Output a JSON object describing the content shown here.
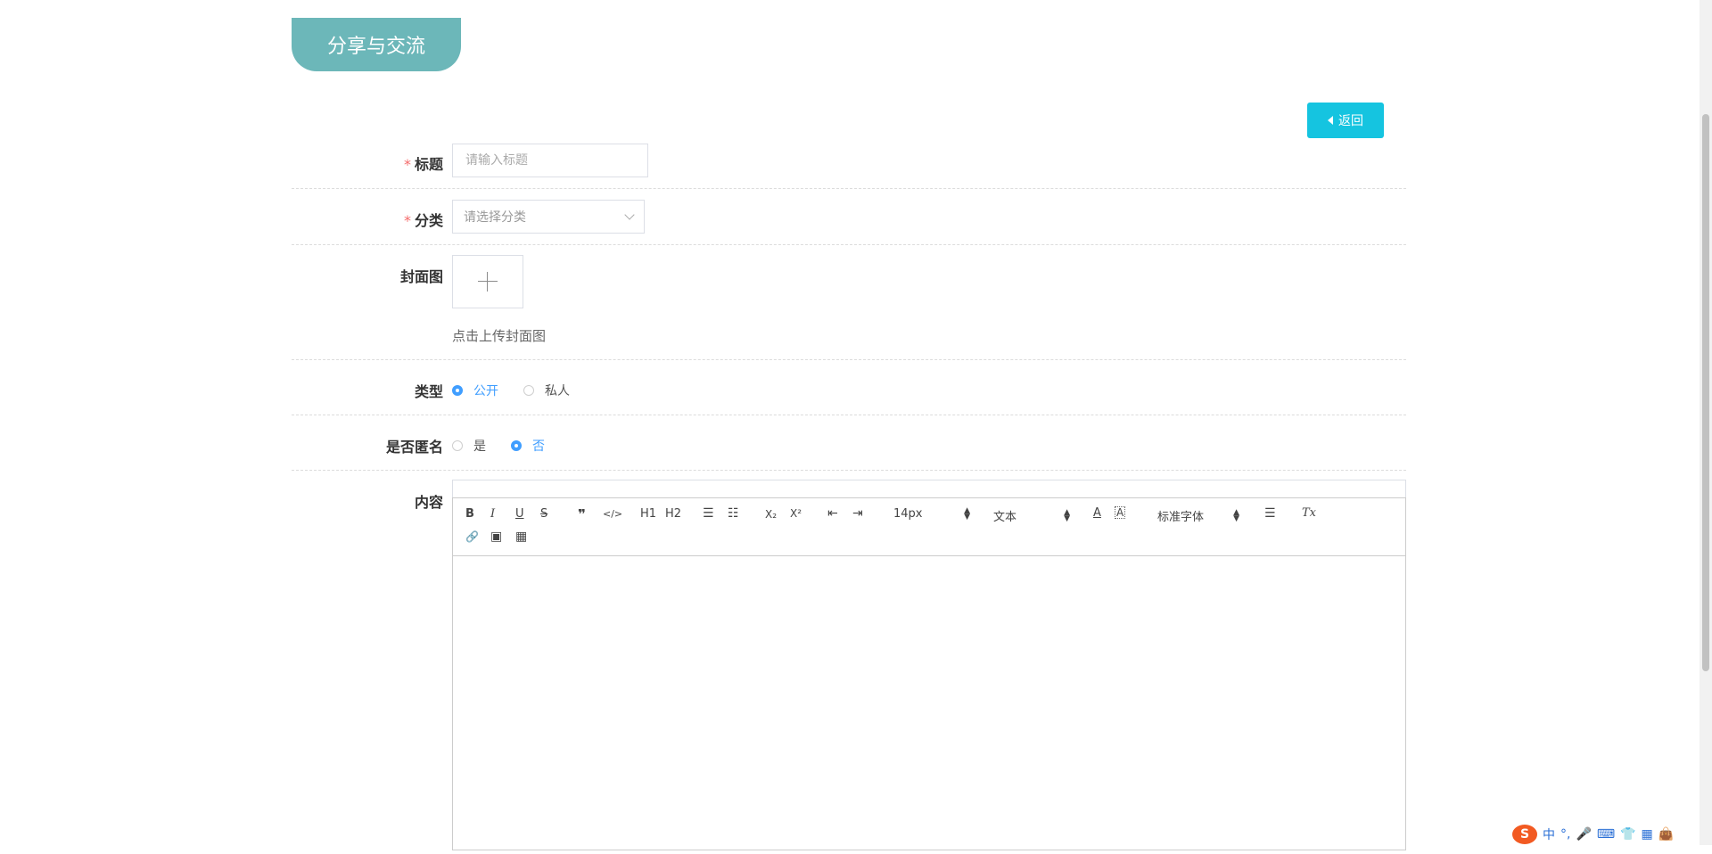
{
  "page_tab": {
    "title": "分享与交流"
  },
  "back_button": {
    "label": "返回"
  },
  "form": {
    "title": {
      "label": "标题",
      "required_mark": "*",
      "placeholder": "请输入标题"
    },
    "category": {
      "label": "分类",
      "required_mark": "*",
      "placeholder": "请选择分类"
    },
    "cover": {
      "label": "封面图",
      "hint": "点击上传封面图"
    },
    "type": {
      "label": "类型",
      "options": [
        "公开",
        "私人"
      ],
      "selected": "公开"
    },
    "anonymous": {
      "label": "是否匿名",
      "options": [
        "是",
        "否"
      ],
      "selected": "否"
    },
    "content": {
      "label": "内容",
      "toolbar": {
        "bold": "B",
        "italic": "I",
        "underline": "U",
        "strike": "S",
        "blockquote": "❞",
        "code": "</>",
        "h1": "H1",
        "h2": "H2",
        "ordered_list": "☰",
        "bullet_list": "☷",
        "subscript": "X₂",
        "superscript": "X²",
        "outdent": "⇤",
        "indent": "⇥",
        "size": "14px",
        "header": "文本",
        "color": "A",
        "background": "A",
        "font": "标准字体",
        "align": "☰",
        "clean": "Tx",
        "link": "🔗",
        "image": "▣",
        "video": "▦"
      }
    }
  },
  "ime": {
    "items": [
      "中",
      "°,",
      "🎤",
      "⌨",
      "👕",
      "▦",
      "👜"
    ],
    "logo": "S"
  },
  "colors": {
    "accent": "#409eff",
    "tab": "#6cb7b9",
    "back_button": "#15c4e0",
    "required": "#f56c6c"
  }
}
